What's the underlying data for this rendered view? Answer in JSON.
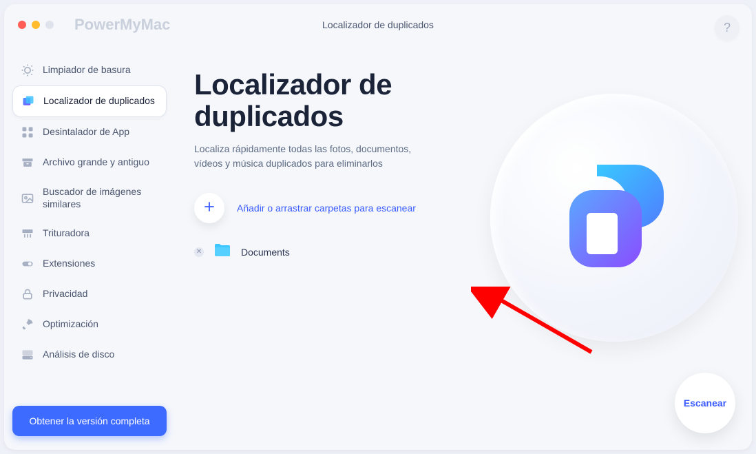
{
  "app": {
    "brand": "PowerMyMac",
    "window_title": "Localizador de duplicados",
    "help_symbol": "?"
  },
  "sidebar": {
    "items": [
      {
        "id": "junk",
        "label": "Limpiador de basura"
      },
      {
        "id": "duplicates",
        "label": "Localizador de duplicados",
        "active": true
      },
      {
        "id": "uninstaller",
        "label": "Desintalador de App"
      },
      {
        "id": "largeold",
        "label": "Archivo grande y antiguo"
      },
      {
        "id": "similar",
        "label": "Buscador de imágenes similares"
      },
      {
        "id": "shredder",
        "label": "Trituradora"
      },
      {
        "id": "extensions",
        "label": "Extensiones"
      },
      {
        "id": "privacy",
        "label": "Privacidad"
      },
      {
        "id": "optimize",
        "label": "Optimización"
      },
      {
        "id": "diskanalyze",
        "label": "Análisis de disco"
      }
    ],
    "upgrade_label": "Obtener la versión completa"
  },
  "main": {
    "title": "Localizador de duplicados",
    "description": "Localiza rápidamente todas las fotos, documentos, vídeos y música duplicados para eliminarlos",
    "add_label": "Añadir o arrastrar carpetas para escanear",
    "folders": [
      {
        "name": "Documents"
      }
    ],
    "scan_label": "Escanear"
  },
  "colors": {
    "accent": "#3b5bff",
    "arrow": "#ff0000"
  }
}
